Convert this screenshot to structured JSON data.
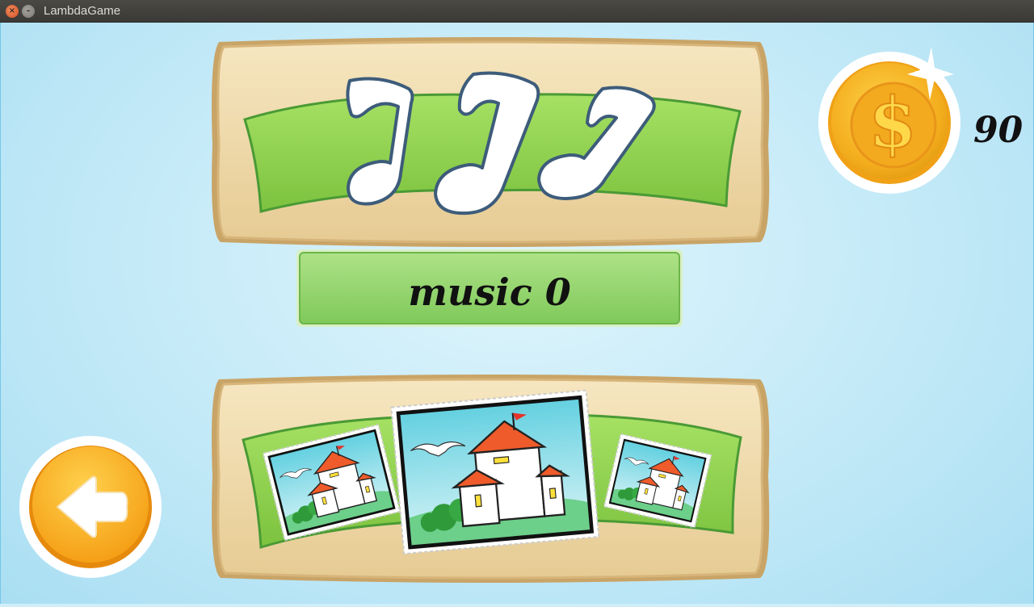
{
  "window": {
    "title": "LambdaGame"
  },
  "menu": {
    "category_icon": "music-notes-icon",
    "selected_label": "music 0"
  },
  "coins": {
    "icon": "gold-coin-icon",
    "count": "90",
    "symbol": "$"
  },
  "picture_selector": {
    "thumbnails": [
      {
        "name": "previous-picture-thumbnail",
        "icon": "house-picture-icon"
      },
      {
        "name": "current-picture-thumbnail",
        "icon": "house-picture-icon"
      },
      {
        "name": "next-picture-thumbnail",
        "icon": "house-picture-icon"
      }
    ]
  },
  "back_button": {
    "icon": "back-arrow-icon"
  },
  "colors": {
    "background": "#bfe8f7",
    "panel_wood": "#ecd5a3",
    "ribbon_green": "#8fd14f",
    "label_green": "#93d466",
    "coin_gold": "#f5b82a",
    "back_orange": "#f5a623"
  }
}
